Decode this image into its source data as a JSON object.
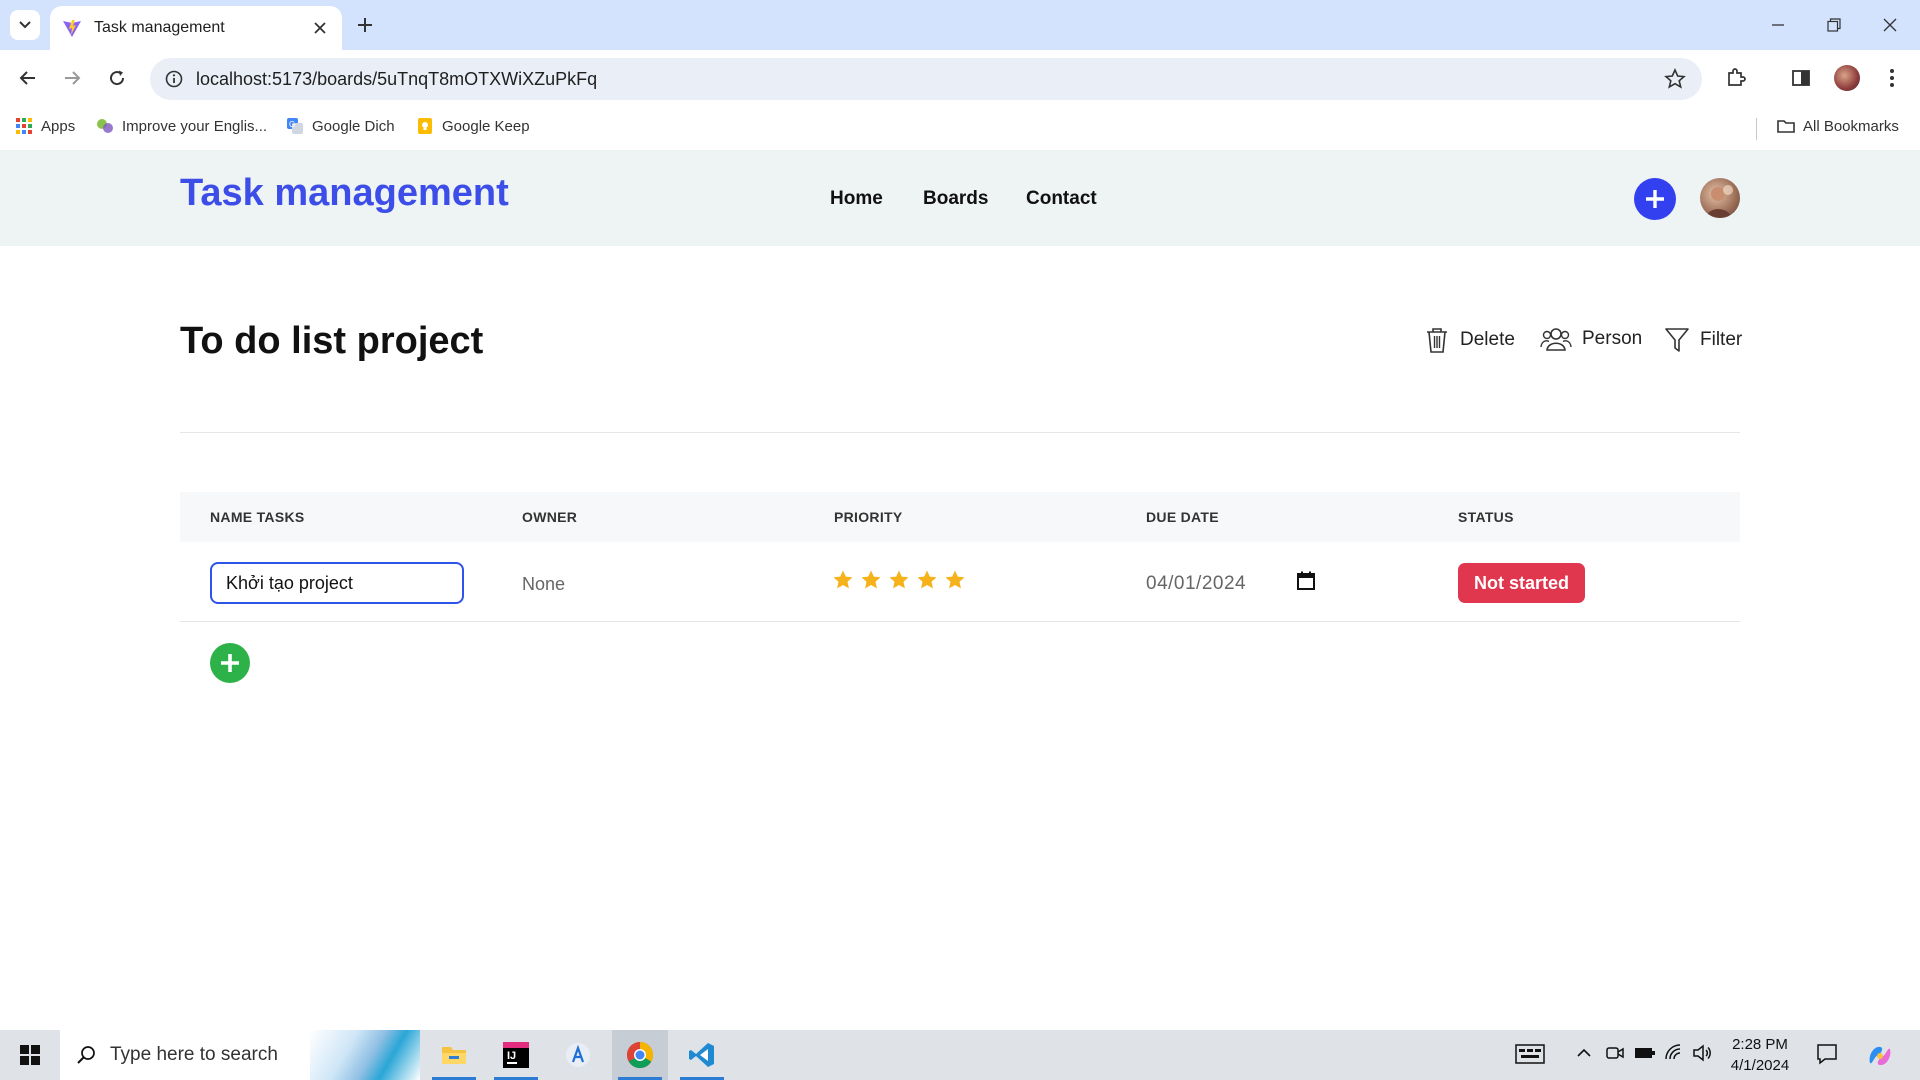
{
  "browser": {
    "tab_title": "Task management",
    "url": "localhost:5173/boards/5uTnqT8mOTXWiXZuPkFq",
    "bookmarks": [
      {
        "label": "Apps",
        "icon": "apps-grid-icon"
      },
      {
        "label": "Improve your Englis...",
        "icon": "improve-english-icon"
      },
      {
        "label": "Google Dich",
        "icon": "google-translate-icon"
      },
      {
        "label": "Google Keep",
        "icon": "google-keep-icon"
      }
    ],
    "all_bookmarks": "All Bookmarks"
  },
  "app": {
    "brand": "Task management",
    "nav": [
      "Home",
      "Boards",
      "Contact"
    ]
  },
  "board": {
    "title": "To do list project",
    "actions": [
      {
        "label": "Delete",
        "icon": "trash-icon"
      },
      {
        "label": "Person",
        "icon": "people-icon"
      },
      {
        "label": "Filter",
        "icon": "filter-icon"
      }
    ],
    "columns": [
      "NAME TASKS",
      "OWNER",
      "PRIORITY",
      "DUE DATE",
      "STATUS"
    ],
    "rows": [
      {
        "name": "Khởi tạo project",
        "owner": "None",
        "priority_stars": 5,
        "due_date": "04/01/2024",
        "status": "Not started",
        "status_color": "#e0364e"
      }
    ]
  },
  "colors": {
    "brand": "#3d4de8",
    "add_button": "#3340f0",
    "add_row_button": "#2db24a",
    "star": "#f5b21a"
  },
  "taskbar": {
    "search_placeholder": "Type here to search",
    "apps": [
      "file-explorer-icon",
      "intellij-icon",
      "app-store-icon",
      "chrome-icon",
      "vscode-icon"
    ],
    "time": "2:28 PM",
    "date": "4/1/2024"
  }
}
